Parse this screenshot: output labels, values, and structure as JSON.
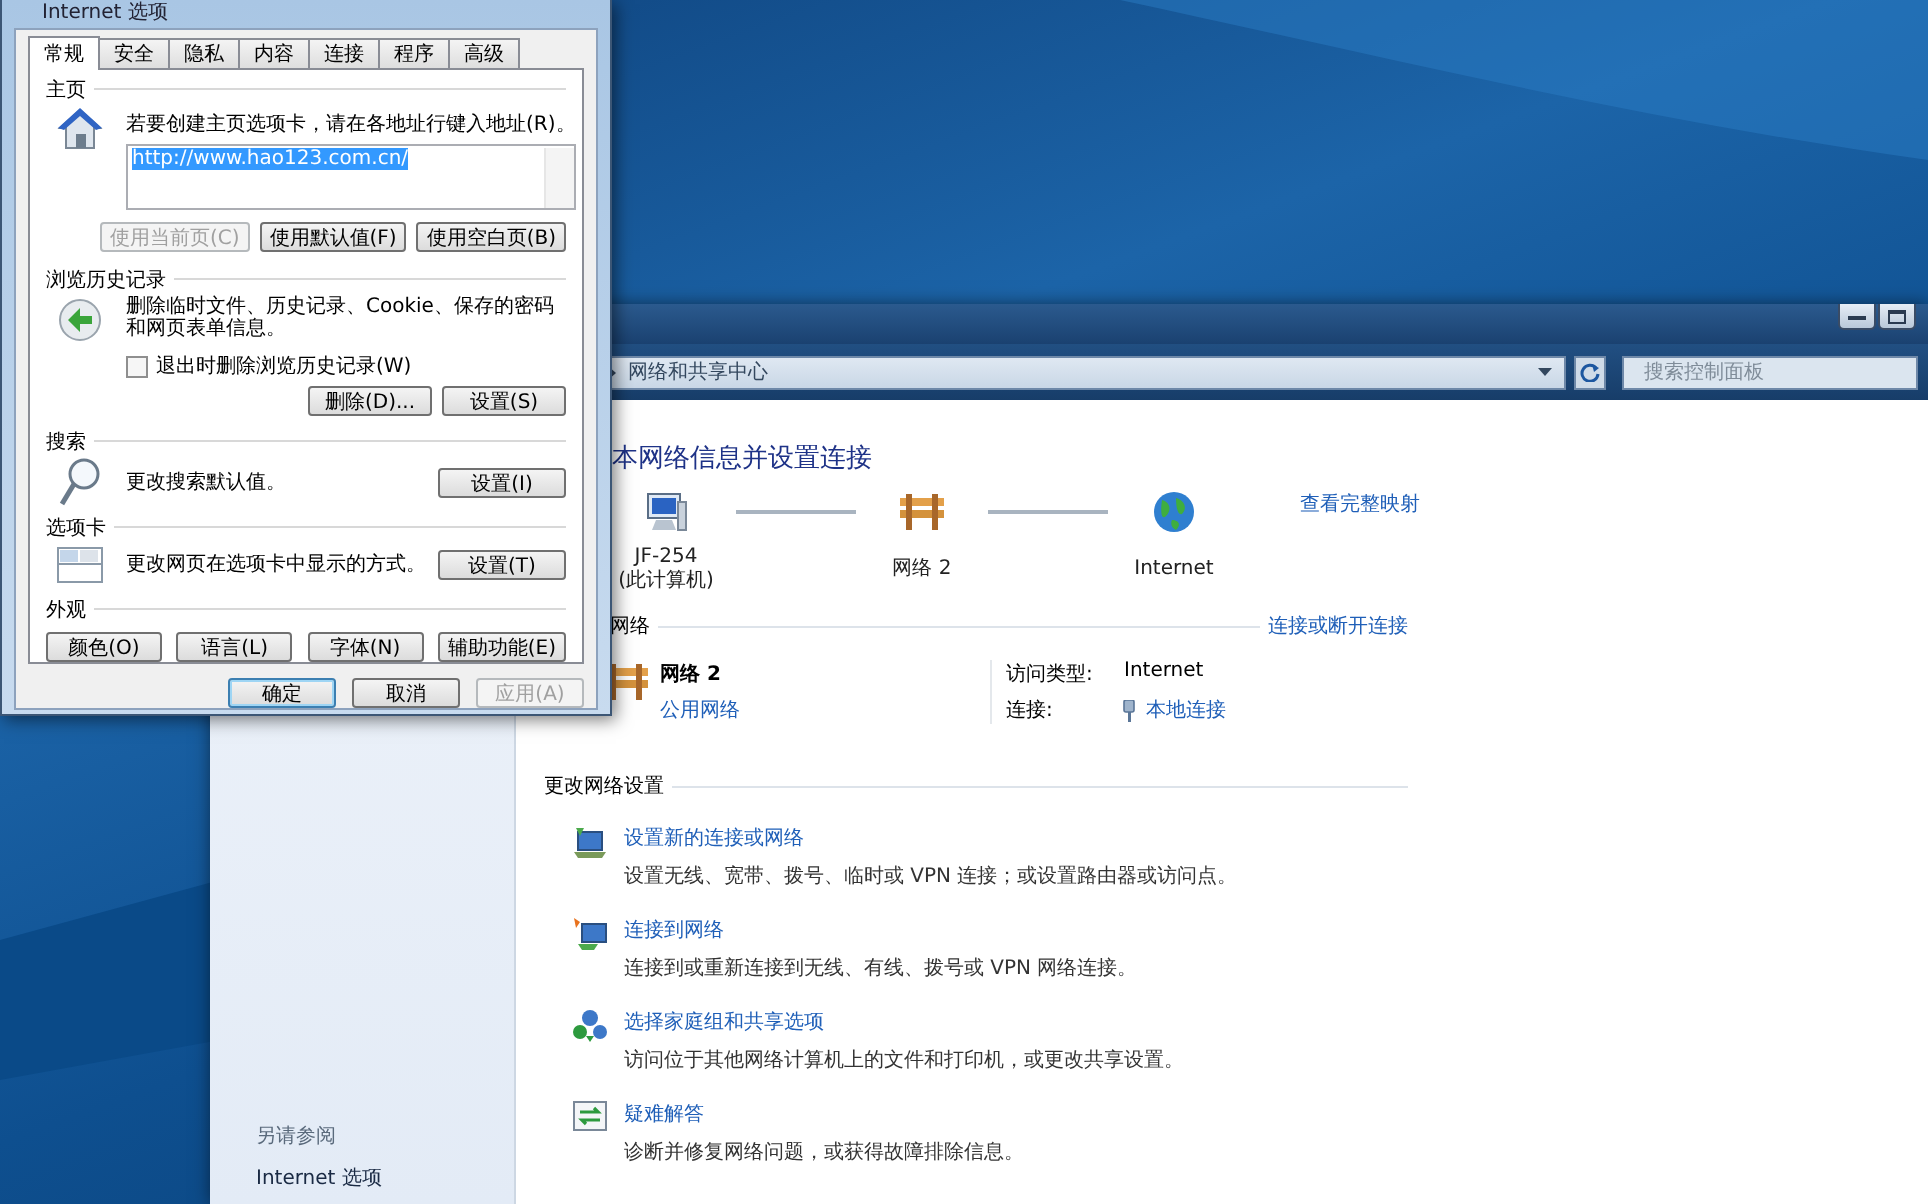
{
  "options_dialog": {
    "title": "Internet 选项",
    "tabs": [
      {
        "label": "常规",
        "selected": true
      },
      {
        "label": "安全",
        "selected": false
      },
      {
        "label": "隐私",
        "selected": false
      },
      {
        "label": "内容",
        "selected": false
      },
      {
        "label": "连接",
        "selected": false
      },
      {
        "label": "程序",
        "selected": false
      },
      {
        "label": "高级",
        "selected": false
      }
    ],
    "home_page": {
      "heading": "主页",
      "instruction": "若要创建主页选项卡，请在各地址行键入地址(R)。",
      "address_value": "http://www.hao123.com.cn/",
      "buttons": [
        {
          "label": "使用当前页(C)",
          "disabled": true
        },
        {
          "label": "使用默认值(F)",
          "disabled": false
        },
        {
          "label": "使用空白页(B)",
          "disabled": false
        }
      ]
    },
    "history": {
      "heading": "浏览历史记录",
      "description": "删除临时文件、历史记录、Cookie、保存的密码和网页表单信息。",
      "checkbox": {
        "label": "退出时删除浏览历史记录(W)",
        "checked": false
      },
      "buttons": [
        {
          "label": "删除(D)...",
          "disabled": false
        },
        {
          "label": "设置(S)",
          "disabled": false
        }
      ]
    },
    "search": {
      "heading": "搜索",
      "description": "更改搜索默认值。",
      "button": "设置(I)"
    },
    "tabs_section": {
      "heading": "选项卡",
      "description": "更改网页在选项卡中显示的方式。",
      "button": "设置(T)"
    },
    "appearance": {
      "heading": "外观",
      "buttons": [
        "颜色(O)",
        "语言(L)",
        "字体(N)",
        "辅助功能(E)"
      ]
    },
    "footer_buttons": [
      {
        "label": "确定",
        "disabled": false,
        "default": true
      },
      {
        "label": "取消",
        "disabled": false,
        "default": false
      },
      {
        "label": "应用(A)",
        "disabled": true,
        "default": false
      }
    ]
  },
  "network_window": {
    "breadcrumb": "网络和共享中心",
    "search_placeholder": "搜索控制面板",
    "sidebar": {
      "heading": "另请参阅",
      "links": [
        "Internet 选项"
      ]
    },
    "title": "本网络信息并设置连接",
    "map": {
      "nodes": [
        {
          "kind": "computer",
          "name": "JF-254",
          "caption": "(此计算机)"
        },
        {
          "kind": "network",
          "name": "网络 2"
        },
        {
          "kind": "internet",
          "name": "Internet"
        }
      ],
      "full_map_link": "查看完整映射"
    },
    "active_networks": {
      "heading": "网络",
      "link": "连接或断开连接",
      "network": {
        "name": "网络 2",
        "type": "公用网络",
        "properties": [
          {
            "label": "访问类型:",
            "value": "Internet",
            "kind": "text"
          },
          {
            "label": "连接:",
            "value": "本地连接",
            "kind": "link"
          }
        ]
      }
    },
    "change_settings": {
      "heading": "更改网络设置",
      "tasks": [
        {
          "kind": "setup",
          "title": "设置新的连接或网络",
          "description": "设置无线、宽带、拨号、临时或 VPN 连接；或设置路由器或访问点。"
        },
        {
          "kind": "connect",
          "title": "连接到网络",
          "description": "连接到或重新连接到无线、有线、拨号或 VPN 网络连接。"
        },
        {
          "kind": "homegroup",
          "title": "选择家庭组和共享选项",
          "description": "访问位于其他网络计算机上的文件和打印机，或更改共享设置。"
        },
        {
          "kind": "troubleshoot",
          "title": "疑难解答",
          "description": "诊断并修复网络问题，或获得故障排除信息。"
        }
      ]
    }
  }
}
